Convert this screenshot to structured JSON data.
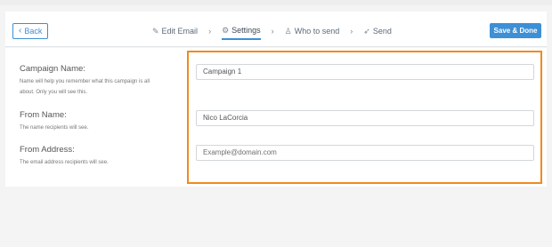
{
  "toolbar": {
    "back_label": "Back",
    "steps": [
      {
        "label": "Edit Email",
        "icon": "edit-icon"
      },
      {
        "label": "Settings",
        "icon": "gear-icon"
      },
      {
        "label": "Who to send",
        "icon": "user-icon"
      },
      {
        "label": "Send",
        "icon": "send-icon"
      }
    ],
    "active_step": "Settings",
    "save_label": "Save & Done"
  },
  "form": {
    "campaign_name": {
      "label": "Campaign Name:",
      "help": "Name will help you remember what this campaign is all about. Only you will see this.",
      "value": "Campaign 1"
    },
    "from_name": {
      "label": "From Name:",
      "help": "The name recipients will see.",
      "value": "Nico LaCorcia"
    },
    "from_address": {
      "label": "From Address:",
      "help": "The email address recipients will see.",
      "placeholder": "Example@domain.com"
    }
  },
  "colors": {
    "accent": "#3d8fd6",
    "highlight": "#f08a1e"
  }
}
